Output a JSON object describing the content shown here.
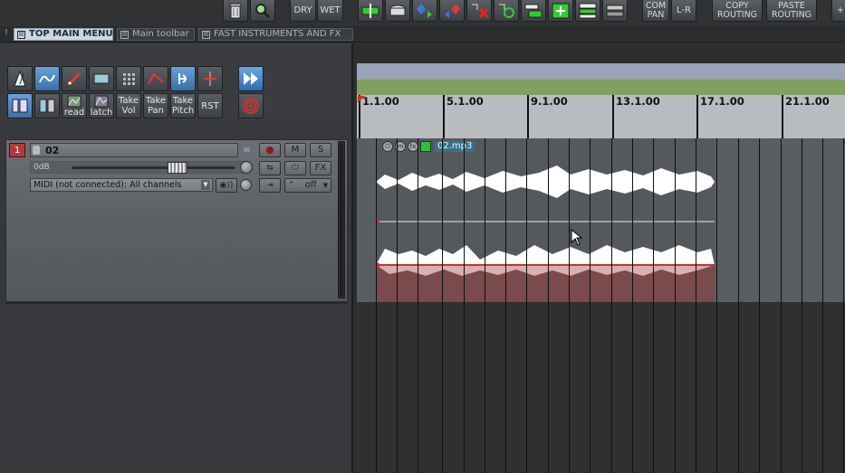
{
  "toolbar": {
    "dry_label": "DRY",
    "wet_label": "WET",
    "com_pan_line1": "COM",
    "com_pan_line2": "PAN",
    "lr_label": "L-R",
    "copy_routing_line1": "COPY",
    "copy_routing_line2": "ROUTING",
    "paste_routing_line1": "PASTE",
    "paste_routing_line2": "ROUTING",
    "more_label": "+"
  },
  "tabs": [
    {
      "label": "TOP MAIN MENU",
      "active": true
    },
    {
      "label": "Main toolbar",
      "active": false
    },
    {
      "label": "FAST INSTRUMENTS AND FX",
      "active": false
    }
  ],
  "tab_close_glyph": "☒",
  "tab_handle": "!",
  "tcp_toolbar": {
    "read_label": "read",
    "latch_label": "latch",
    "take_vol_line1": "Take",
    "take_vol_line2": "Vol",
    "take_pan_line1": "Take",
    "take_pan_line2": "Pan",
    "take_pitch_line1": "Take",
    "take_pitch_line2": "Pitch",
    "rst_label": "RST"
  },
  "track": {
    "number": "1",
    "name": "02",
    "mute_label": "M",
    "solo_label": "S",
    "volume_label": "0dB",
    "fx_label": "FX",
    "midi_input": "MIDI (not connected): All channels",
    "automation_mode": "off"
  },
  "timeline": {
    "bars": [
      "1.1.00",
      "5.1.00",
      "9.1.00",
      "13.1.00",
      "17.1.00",
      "21.1.00"
    ]
  },
  "media_item": {
    "name": "02.mp3",
    "mute_glyph": "m",
    "fx_glyph": "fx"
  },
  "colors": {
    "record_arm": "#b33a3a",
    "item_name_bg": "#3a6f8a",
    "ruler_green": "#7fa060",
    "ruler_blue": "#9aa3b8"
  }
}
